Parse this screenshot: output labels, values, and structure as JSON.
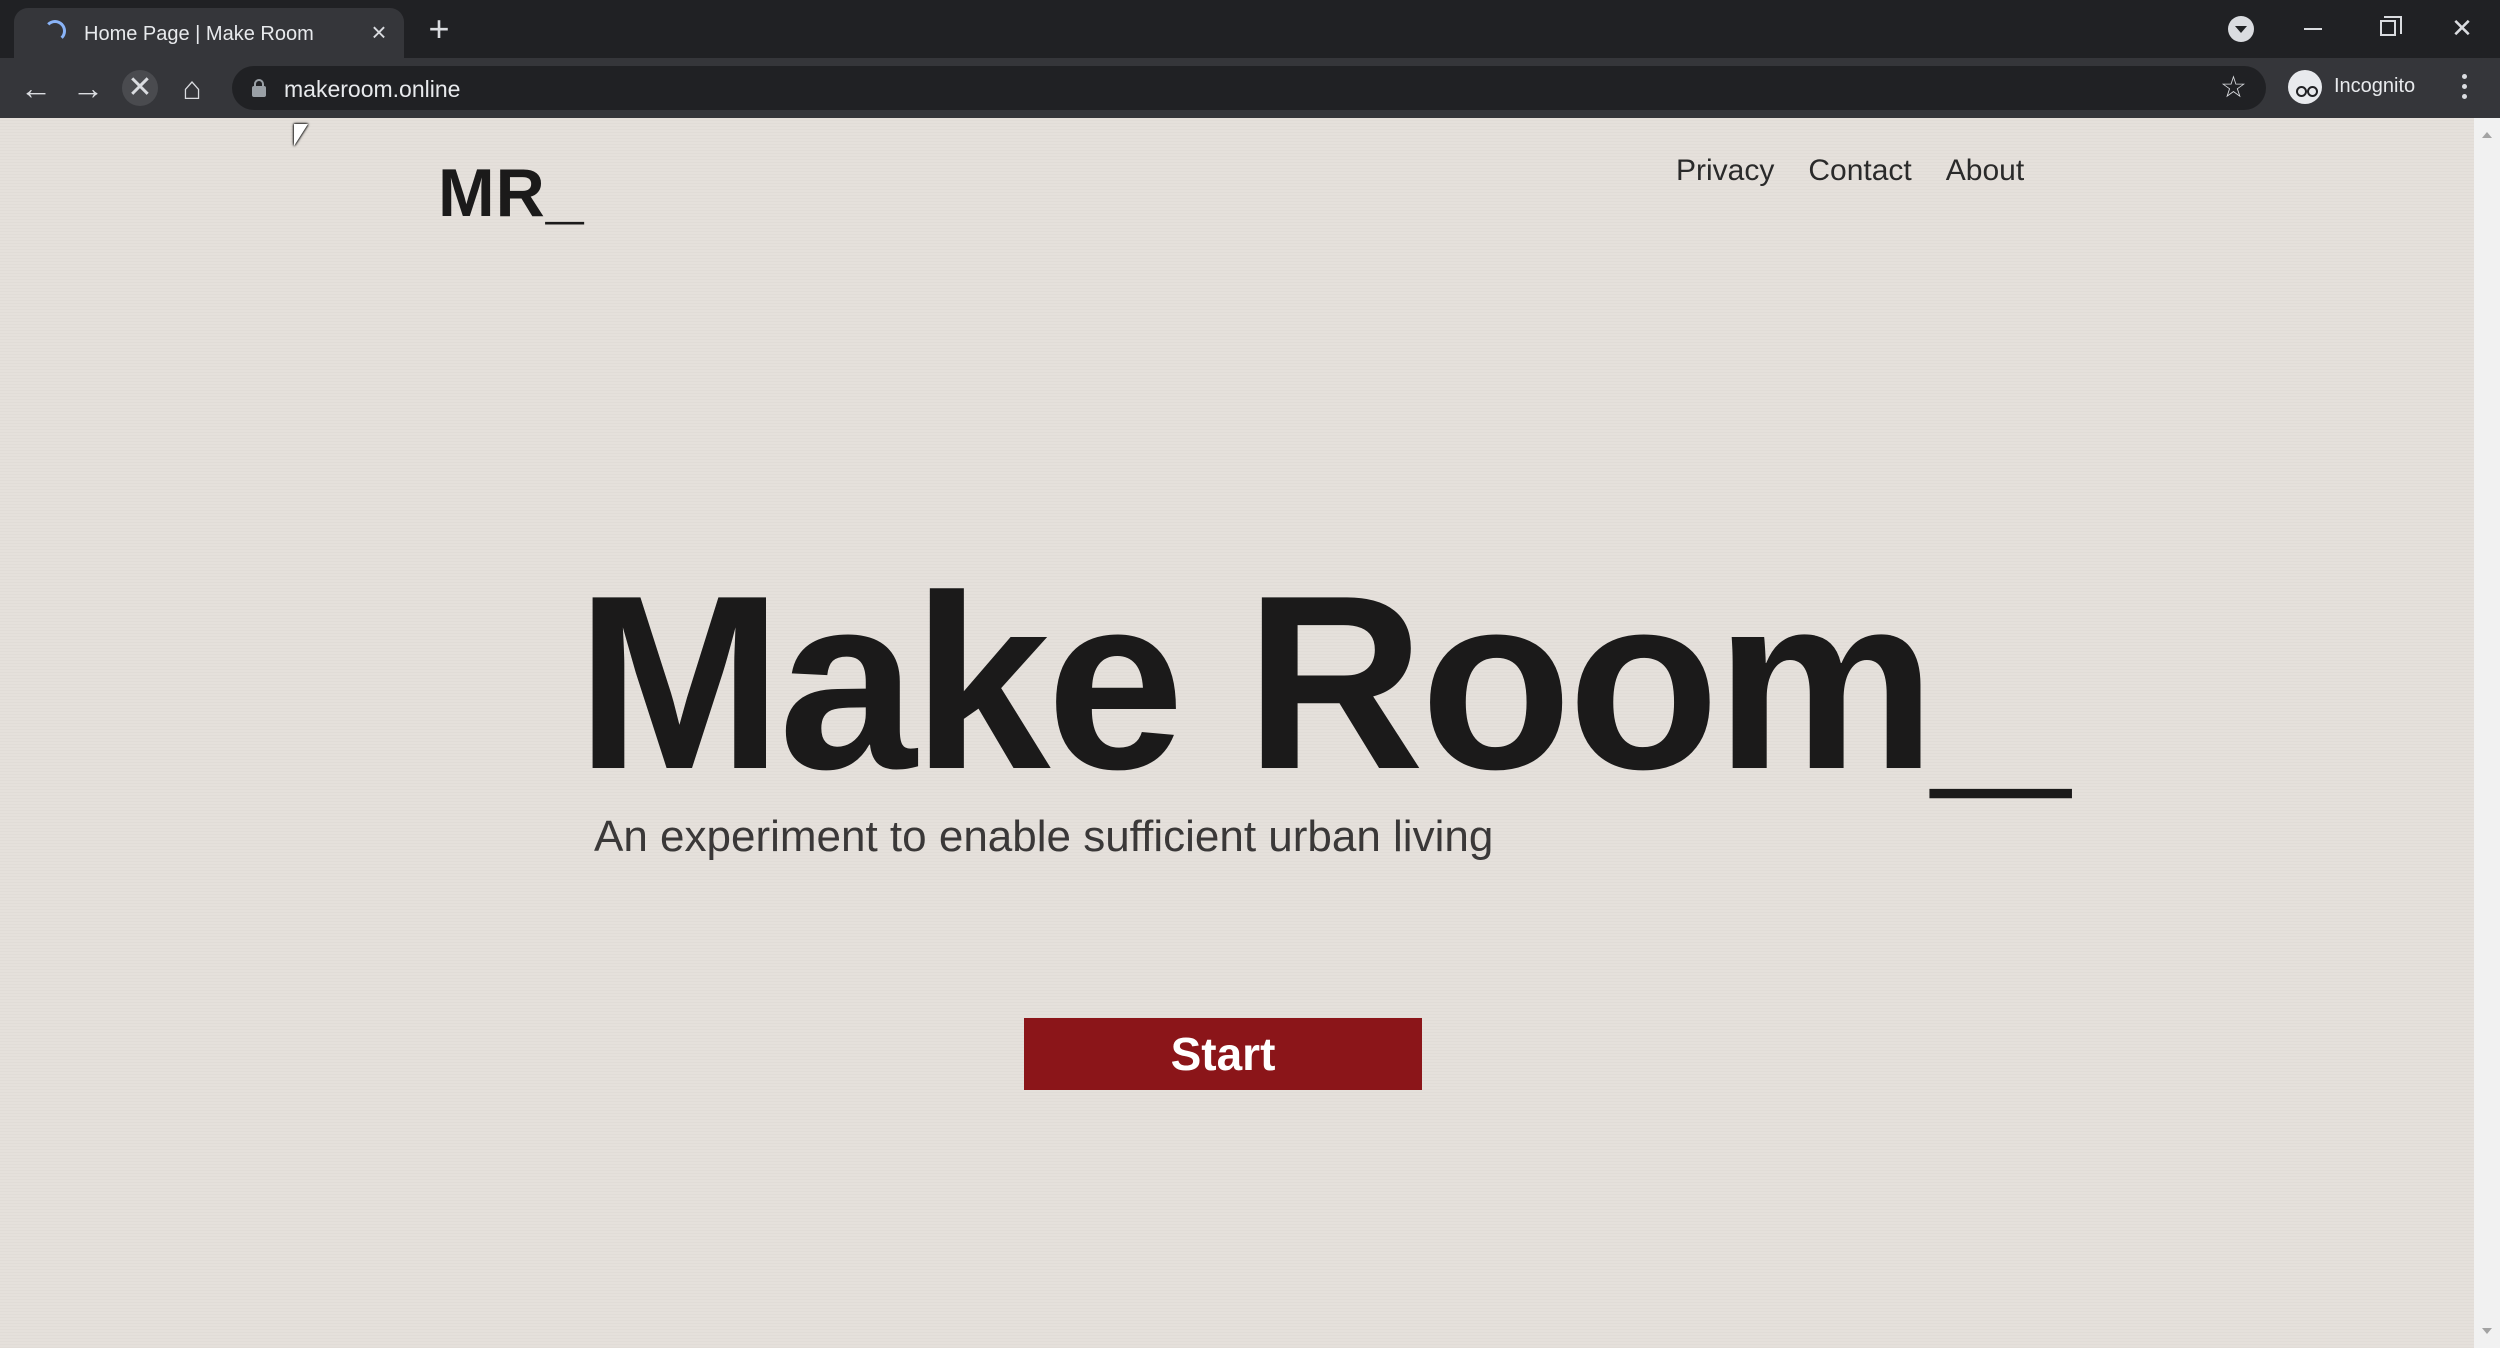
{
  "browser": {
    "tab_title": "Home Page | Make Room",
    "new_tab_label": "+",
    "url": "makeroom.online",
    "profile_label": "Incognito"
  },
  "page": {
    "logo": "MR_",
    "nav": [
      "Privacy",
      "Contact",
      "About"
    ],
    "hero_title": "Make Room_",
    "hero_subtitle": "An experiment to enable sufficient urban living",
    "start_label": "Start"
  },
  "colors": {
    "page_bg": "#e5e0db",
    "accent": "#8b1519",
    "text": "#1b1a1a"
  }
}
